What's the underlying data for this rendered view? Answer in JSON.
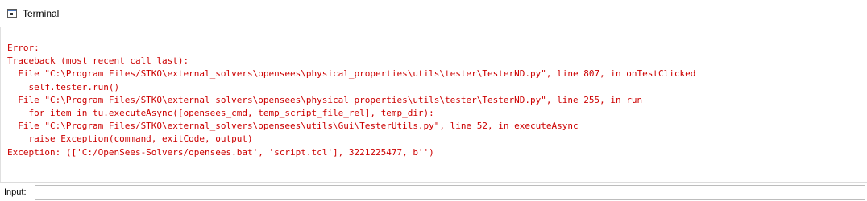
{
  "window": {
    "title": "Terminal",
    "title_icon": "terminal-window-icon"
  },
  "terminal": {
    "text_color": "#cc0000",
    "lines": [
      "Error:",
      "Traceback (most recent call last):",
      "  File \"C:\\Program Files/STKO\\external_solvers\\opensees\\physical_properties\\utils\\tester\\TesterND.py\", line 807, in onTestClicked",
      "    self.tester.run()",
      "  File \"C:\\Program Files/STKO\\external_solvers\\opensees\\physical_properties\\utils\\tester\\TesterND.py\", line 255, in run",
      "    for item in tu.executeAsync([opensees_cmd, temp_script_file_rel], temp_dir):",
      "  File \"C:\\Program Files/STKO\\external_solvers\\opensees\\utils\\Gui\\TesterUtils.py\", line 52, in executeAsync",
      "    raise Exception(command, exitCode, output)",
      "Exception: (['C:/OpenSees-Solvers/opensees.bat', 'script.tcl'], 3221225477, b'')"
    ]
  },
  "input": {
    "label": "Input:",
    "value": "",
    "placeholder": ""
  }
}
